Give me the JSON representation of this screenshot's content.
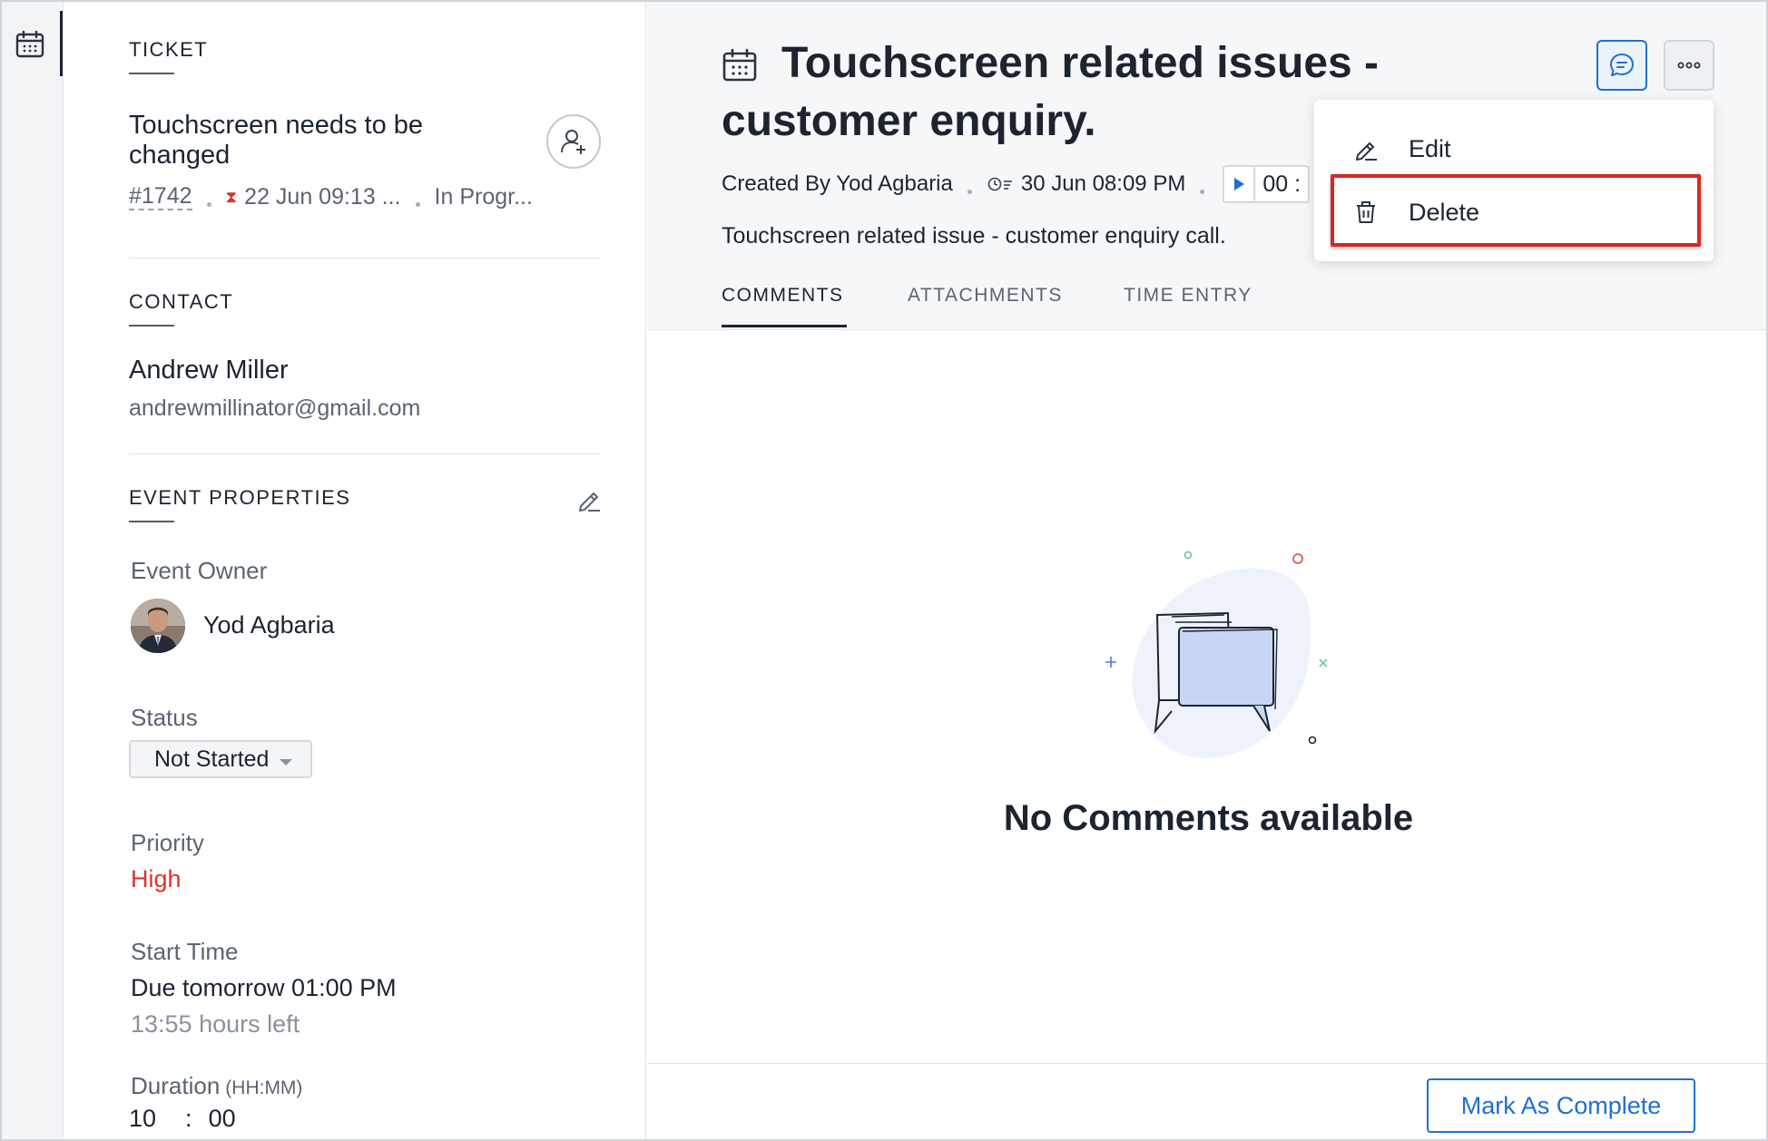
{
  "ticket_section": {
    "heading": "TICKET",
    "title": "Touchscreen needs to be changed",
    "id": "#1742",
    "due": "22 Jun 09:13 ...",
    "status": "In Progr..."
  },
  "contact_section": {
    "heading": "CONTACT",
    "name": "Andrew Miller",
    "email": "andrewmillinator@gmail.com"
  },
  "event_properties": {
    "heading": "EVENT PROPERTIES",
    "owner_label": "Event Owner",
    "owner_name": "Yod Agbaria",
    "status_label": "Status",
    "status_value": "Not Started",
    "priority_label": "Priority",
    "priority_value": "High",
    "start_label": "Start Time",
    "start_value": "Due tomorrow 01:00 PM",
    "hours_left": "13:55 hours left",
    "duration_label": "Duration",
    "duration_unit": "(HH:MM)",
    "duration_hours": "10",
    "duration_sep": ":",
    "duration_minutes": "00"
  },
  "event": {
    "title": "Touchscreen related issues - customer enquiry.",
    "created_by": "Created By Yod Agbaria",
    "created_at": "30 Jun 08:09 PM",
    "timer": "00 :",
    "description": "Touchscreen related issue - customer enquiry call."
  },
  "tabs": [
    {
      "label": "COMMENTS",
      "active": true
    },
    {
      "label": "ATTACHMENTS",
      "active": false
    },
    {
      "label": "TIME ENTRY",
      "active": false
    }
  ],
  "empty_state": {
    "text": "No Comments available"
  },
  "footer": {
    "complete_label": "Mark As Complete"
  },
  "menu": {
    "items": [
      {
        "label": "Edit",
        "icon": "pencil-icon"
      },
      {
        "label": "Delete",
        "icon": "trash-icon"
      }
    ]
  },
  "colors": {
    "accent": "#1f6fd1",
    "priority_high": "#d9342b",
    "highlight": "#d42a23"
  }
}
